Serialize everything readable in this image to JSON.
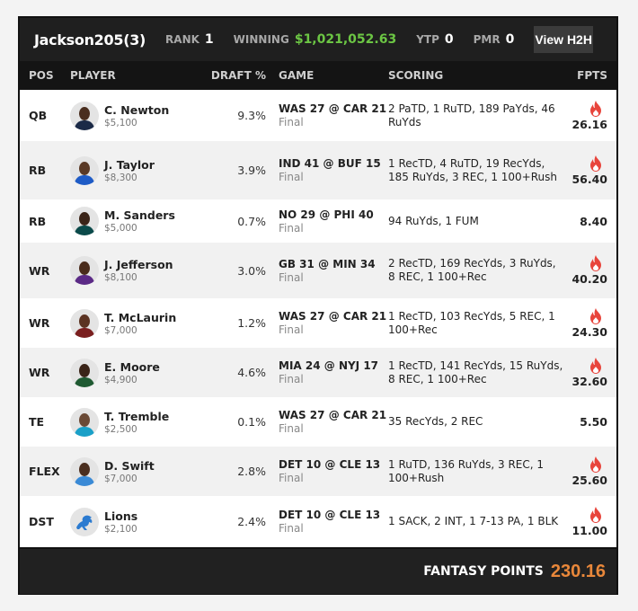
{
  "header": {
    "username": "Jackson205",
    "entry_count": "(3)",
    "rank_label": "RANK",
    "rank_value": "1",
    "winning_label": "WINNING",
    "winning_value": "$1,021,052.63",
    "ytp_label": "YTP",
    "ytp_value": "0",
    "pmr_label": "PMR",
    "pmr_value": "0",
    "h2h_button": "View H2H"
  },
  "columns": {
    "pos": "POS",
    "player": "PLAYER",
    "draft": "DRAFT %",
    "game": "GAME",
    "scoring": "SCORING",
    "fpts": "FPTS"
  },
  "colors": {
    "accent_orange": "#e8873a",
    "winning_green": "#6cc644",
    "flame_red": "#e8453c"
  },
  "rows": [
    {
      "pos": "QB",
      "name": "C. Newton",
      "salary": "$5,100",
      "draft": "9.3%",
      "away": "WAS 27",
      "at": "@",
      "home": "CAR 21",
      "status": "Final",
      "scoring": "2 PaTD, 1 RuTD, 189 PaYds, 46 RuYds",
      "fpts": "26.16",
      "hot": true,
      "skin": "#4a2e1f",
      "jersey": "#1b2a47",
      "h": 57
    },
    {
      "pos": "RB",
      "name": "J. Taylor",
      "salary": "$8,300",
      "draft": "3.9%",
      "away": "IND 41",
      "at": "@",
      "home": "BUF 15",
      "status": "Final",
      "scoring": "1 RecTD, 4 RuTD, 19 RecYds, 185 RuYds, 3 REC, 1 100+Rush",
      "fpts": "56.40",
      "hot": true,
      "skin": "#5a3a26",
      "jersey": "#1e5bc6",
      "h": 65
    },
    {
      "pos": "RB",
      "name": "M. Sanders",
      "salary": "$5,000",
      "draft": "0.7%",
      "away": "NO 29",
      "at": "@",
      "home": "PHI 40",
      "status": "Final",
      "scoring": "94 RuYds, 1 FUM",
      "fpts": "8.40",
      "hot": false,
      "skin": "#3b2418",
      "jersey": "#0b4a4a",
      "h": 48
    },
    {
      "pos": "WR",
      "name": "J. Jefferson",
      "salary": "$8,100",
      "draft": "3.0%",
      "away": "GB 31",
      "at": "@",
      "home": "MIN 34",
      "status": "Final",
      "scoring": "2 RecTD, 169 RecYds, 3 RuYds, 8 REC, 1 100+Rec",
      "fpts": "40.20",
      "hot": true,
      "skin": "#4a2c1c",
      "jersey": "#5b2a86",
      "h": 62
    },
    {
      "pos": "WR",
      "name": "T. McLaurin",
      "salary": "$7,000",
      "draft": "1.2%",
      "away": "WAS 27",
      "at": "@",
      "home": "CAR 21",
      "status": "Final",
      "scoring": "1 RecTD, 103 RecYds, 5 REC, 1 100+Rec",
      "fpts": "24.30",
      "hot": true,
      "skin": "#5b3322",
      "jersey": "#7a1f1f",
      "h": 55
    },
    {
      "pos": "WR",
      "name": "E. Moore",
      "salary": "$4,900",
      "draft": "4.6%",
      "away": "MIA 24",
      "at": "@",
      "home": "NYJ 17",
      "status": "Final",
      "scoring": "1 RecTD, 141 RecYds, 15 RuYds, 8 REC, 1 100+Rec",
      "fpts": "32.60",
      "hot": true,
      "skin": "#3a2418",
      "jersey": "#1f5a32",
      "h": 55
    },
    {
      "pos": "TE",
      "name": "T. Tremble",
      "salary": "$2,500",
      "draft": "0.1%",
      "away": "WAS 27",
      "at": "@",
      "home": "CAR 21",
      "status": "Final",
      "scoring": "35 RecYds, 2 REC",
      "fpts": "5.50",
      "hot": false,
      "skin": "#6a4a36",
      "jersey": "#1aa0c8",
      "h": 55
    },
    {
      "pos": "FLEX",
      "name": "D. Swift",
      "salary": "$7,000",
      "draft": "2.8%",
      "away": "DET 10",
      "at": "@",
      "home": "CLE 13",
      "status": "Final",
      "scoring": "1 RuTD, 136 RuYds, 3 REC, 1 100+Rush",
      "fpts": "25.60",
      "hot": true,
      "skin": "#4a2e1f",
      "jersey": "#3a8ad6",
      "h": 55
    },
    {
      "pos": "DST",
      "name": "Lions",
      "salary": "$2,100",
      "draft": "2.4%",
      "away": "DET 10",
      "at": "@",
      "home": "CLE 13",
      "status": "Final",
      "scoring": "1 SACK, 2 INT, 1 7-13 PA, 1 BLK",
      "fpts": "11.00",
      "hot": true,
      "skin": "",
      "jersey": "#2a7ad0",
      "h": 57,
      "logo": "lions-logo"
    }
  ],
  "footer": {
    "label": "FANTASY POINTS",
    "total": "230.16"
  }
}
